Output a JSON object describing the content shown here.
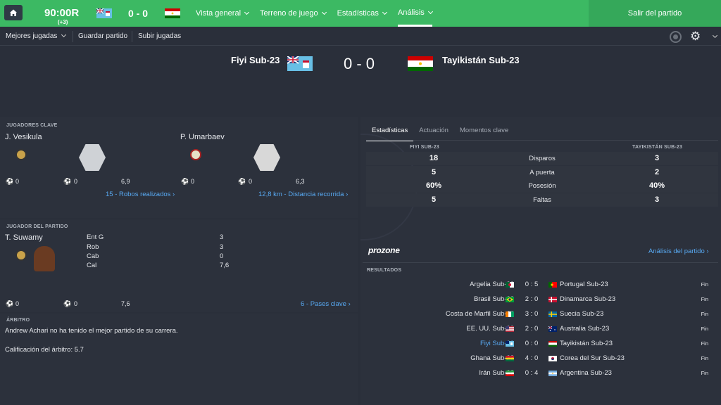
{
  "topbar": {
    "clock": "90:00R",
    "added_time": "(+3)",
    "score": "0 - 0",
    "nav": [
      {
        "label": "Vista general"
      },
      {
        "label": "Terreno de juego"
      },
      {
        "label": "Estadísticas"
      },
      {
        "label": "Análisis"
      }
    ],
    "exit_label": "Salir del partido"
  },
  "subbar": {
    "best_plays": "Mejores jugadas",
    "save_match": "Guardar partido",
    "upload_plays": "Subir jugadas"
  },
  "match": {
    "home": "Fiyi Sub-23",
    "away": "Tayikistán Sub-23",
    "score": "0 - 0"
  },
  "key_players": {
    "title": "JUGADORES CLAVE",
    "home": {
      "name": "J. Vesikula",
      "goals": "0",
      "assists": "0",
      "rating": "6,9",
      "link": "15 - Robos realizados"
    },
    "away": {
      "name": "P. Umarbaev",
      "goals": "0",
      "assists": "0",
      "rating": "6,3",
      "link": "12,8 km - Distancia recorrida"
    }
  },
  "motm": {
    "title": "JUGADOR DEL PARTIDO",
    "name": "T. Suwamy",
    "stats": [
      {
        "label": "Ent G",
        "value": "3"
      },
      {
        "label": "Rob",
        "value": "3"
      },
      {
        "label": "Cab",
        "value": "0"
      },
      {
        "label": "Cal",
        "value": "7,6"
      }
    ],
    "goals": "0",
    "assists": "0",
    "rating": "7,6",
    "link": "6 - Pases clave"
  },
  "referee": {
    "title": "ÁRBITRO",
    "comment": "Andrew Achari no ha tenido el mejor partido de su carrera.",
    "rating": "Calificación del árbitro: 5.7"
  },
  "stats_tabs": [
    {
      "label": "Estadísticas"
    },
    {
      "label": "Actuación"
    },
    {
      "label": "Momentos clave"
    }
  ],
  "stats": {
    "home_header": "FIYI SUB-23",
    "away_header": "TAYIKISTÁN SUB-23",
    "rows": [
      {
        "home": "18",
        "label": "Disparos",
        "away": "3"
      },
      {
        "home": "5",
        "label": "A puerta",
        "away": "2"
      },
      {
        "home": "60%",
        "label": "Posesión",
        "away": "40%"
      },
      {
        "home": "5",
        "label": "Faltas",
        "away": "3"
      }
    ]
  },
  "prozone": {
    "logo": "prozone",
    "link": "Análisis del partido"
  },
  "results": {
    "title": "RESULTADOS",
    "rows": [
      {
        "home": "Argelia Sub-23",
        "score": "0 : 5",
        "away": "Portugal Sub-23",
        "status": "Fin"
      },
      {
        "home": "Brasil Sub-23",
        "score": "2 : 0",
        "away": "Dinamarca Sub-23",
        "status": "Fin"
      },
      {
        "home": "Costa de Marfil Sub-23",
        "score": "3 : 0",
        "away": "Suecia Sub-23",
        "status": "Fin"
      },
      {
        "home": "EE. UU. Sub-23",
        "score": "2 : 0",
        "away": "Australia Sub-23",
        "status": "Fin"
      },
      {
        "home": "Fiyi Sub-23",
        "score": "0 : 0",
        "away": "Tayikistán Sub-23",
        "status": "Fin"
      },
      {
        "home": "Ghana Sub-23",
        "score": "4 : 0",
        "away": "Corea del Sur Sub-23",
        "status": "Fin"
      },
      {
        "home": "Irán Sub-23",
        "score": "0 : 4",
        "away": "Argentina Sub-23",
        "status": "Fin"
      }
    ]
  },
  "colors": {
    "accent": "#3cb963",
    "link": "#58a9f2",
    "background": "#2a2f3a"
  }
}
